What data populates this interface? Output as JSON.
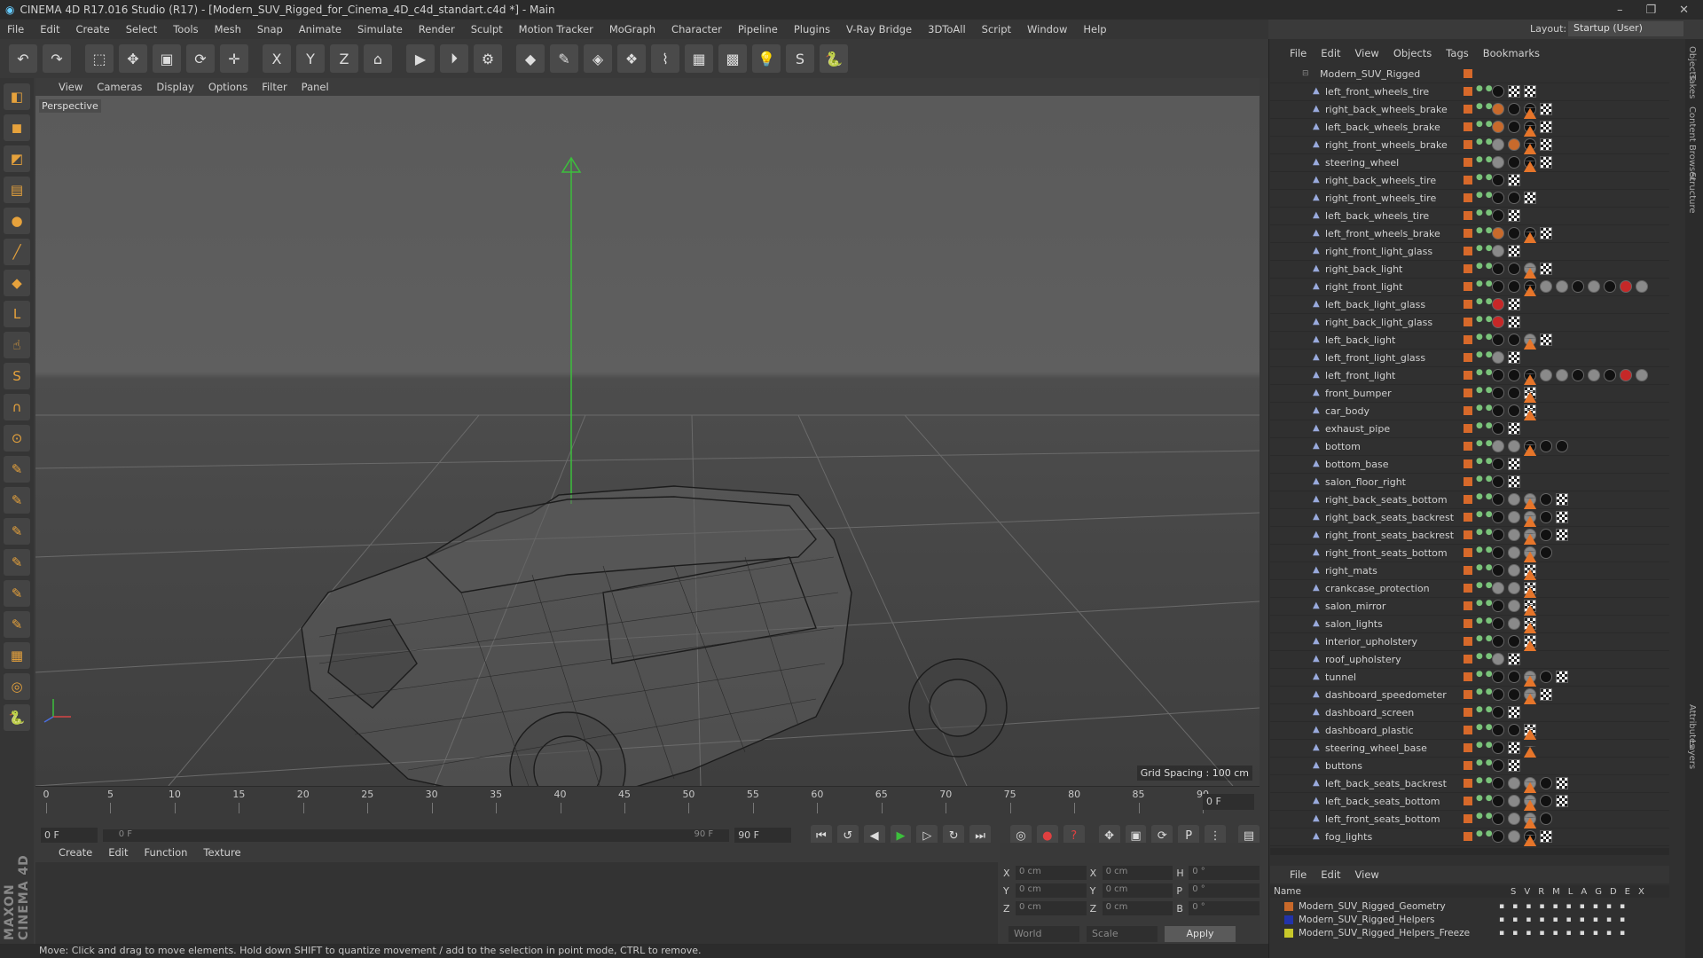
{
  "titlebar": {
    "title": "CINEMA 4D R17.016 Studio (R17) - [Modern_SUV_Rigged_for_Cinema_4D_c4d_standart.c4d *] - Main",
    "controls": [
      "–",
      "❐",
      "✕"
    ]
  },
  "menubar": [
    "File",
    "Edit",
    "Create",
    "Select",
    "Tools",
    "Mesh",
    "Snap",
    "Animate",
    "Simulate",
    "Render",
    "Sculpt",
    "Motion Tracker",
    "MoGraph",
    "Character",
    "Pipeline",
    "Plugins",
    "V-Ray Bridge",
    "3DToAll",
    "Script",
    "Window",
    "Help"
  ],
  "layout": {
    "label": "Layout:",
    "value": "Startup (User)"
  },
  "toolbar_icons": [
    "undo-icon",
    "redo-icon",
    "live-selection-icon",
    "move-icon",
    "scale-icon",
    "rotate-icon",
    "move-last-icon",
    "x-axis-icon",
    "y-axis-icon",
    "z-axis-icon",
    "world-coords-icon",
    "render-view-icon",
    "render-pic-icon",
    "render-settings-icon",
    "cube-icon",
    "pen-icon",
    "subdivision-icon",
    "array-icon",
    "deformer-icon",
    "floor-icon",
    "camera-icon",
    "light-icon",
    "vray-icon",
    "python-icon"
  ],
  "left_tools": [
    "make-editable-icon",
    "model-mode-icon",
    "texture-mode-icon",
    "workplane-icon",
    "points-mode-icon",
    "edges-mode-icon",
    "polygons-mode-icon",
    "axis-icon",
    "tweak-icon",
    "snap-icon",
    "magnet-icon",
    "lock-workplane-icon",
    "brush-icon",
    "brush2-icon",
    "brush3-icon",
    "brush4-icon",
    "brush5-icon",
    "brush6-icon",
    "grid-icon",
    "solo-icon",
    "python-icon"
  ],
  "viewport": {
    "menu": [
      "View",
      "Cameras",
      "Display",
      "Options",
      "Filter",
      "Panel"
    ],
    "label": "Perspective",
    "grid_spacing": "Grid Spacing : 100 cm"
  },
  "timeline": {
    "ticks": [
      "0",
      "5",
      "10",
      "15",
      "20",
      "25",
      "30",
      "35",
      "40",
      "45",
      "50",
      "55",
      "60",
      "65",
      "70",
      "75",
      "80",
      "85",
      "90"
    ],
    "current_frame": "0 F"
  },
  "transport": {
    "start": "0 F",
    "range_start": "0 F",
    "range_end": "90 F",
    "end": "90 F"
  },
  "materials": {
    "menu": [
      "Create",
      "Edit",
      "Function",
      "Texture"
    ]
  },
  "coords": {
    "rows": [
      {
        "a": "X",
        "av": "0 cm",
        "b": "X",
        "bv": "0 cm",
        "c": "H",
        "cv": "0 °"
      },
      {
        "a": "Y",
        "av": "0 cm",
        "b": "Y",
        "bv": "0 cm",
        "c": "P",
        "cv": "0 °"
      },
      {
        "a": "Z",
        "av": "0 cm",
        "b": "Z",
        "bv": "0 cm",
        "c": "B",
        "cv": "0 °"
      }
    ],
    "mode": "World",
    "type": "Scale",
    "apply": "Apply"
  },
  "statusbar": "Move: Click and drag to move elements. Hold down SHIFT to quantize movement / add to the selection in point mode, CTRL to remove.",
  "maxon": "MAXON CINEMA 4D",
  "objects": {
    "menu": [
      "File",
      "Edit",
      "View",
      "Objects",
      "Tags",
      "Bookmarks"
    ],
    "root": "Modern_SUV_Rigged",
    "items": [
      {
        "name": "left_front_wheels_tire",
        "tags": "bck"
      },
      {
        "name": "right_back_wheels_brake",
        "tags": "obbtttc"
      },
      {
        "name": "left_back_wheels_brake",
        "tags": "obbtttc"
      },
      {
        "name": "right_front_wheels_brake",
        "tags": "gobtttc"
      },
      {
        "name": "steering_wheel",
        "tags": "gbbtttc"
      },
      {
        "name": "right_back_wheels_tire",
        "tags": "bc"
      },
      {
        "name": "right_front_wheels_tire",
        "tags": "bbc"
      },
      {
        "name": "left_back_wheels_tire",
        "tags": "bc"
      },
      {
        "name": "left_front_wheels_brake",
        "tags": "obbtttc"
      },
      {
        "name": "right_front_light_glass",
        "tags": "gc"
      },
      {
        "name": "right_back_light",
        "tags": "bbgtttc"
      },
      {
        "name": "right_front_light",
        "tags": "bbbggbgbrgt"
      },
      {
        "name": "left_back_light_glass",
        "tags": "rc"
      },
      {
        "name": "right_back_light_glass",
        "tags": "rc"
      },
      {
        "name": "left_back_light",
        "tags": "bbgtttc"
      },
      {
        "name": "left_front_light_glass",
        "tags": "gc"
      },
      {
        "name": "left_front_light",
        "tags": "bbbggbgbrgt"
      },
      {
        "name": "front_bumper",
        "tags": "bbttc"
      },
      {
        "name": "car_body",
        "tags": "bbttc"
      },
      {
        "name": "exhaust_pipe",
        "tags": "bc"
      },
      {
        "name": "bottom",
        "tags": "ggbbbttttt"
      },
      {
        "name": "bottom_base",
        "tags": "bc"
      },
      {
        "name": "salon_floor_right",
        "tags": "bc"
      },
      {
        "name": "right_back_seats_bottom",
        "tags": "bggbttttc"
      },
      {
        "name": "right_back_seats_backrest",
        "tags": "bggbttttc"
      },
      {
        "name": "right_front_seats_backrest",
        "tags": "bggbttttc"
      },
      {
        "name": "right_front_seats_bottom",
        "tags": "bggbttttt"
      },
      {
        "name": "right_mats",
        "tags": "bgttc"
      },
      {
        "name": "crankcase_protection",
        "tags": "ggttc"
      },
      {
        "name": "salon_mirror",
        "tags": "bgttc"
      },
      {
        "name": "salon_lights",
        "tags": "bgttc"
      },
      {
        "name": "interior_upholstery",
        "tags": "bbttc"
      },
      {
        "name": "roof_upholstery",
        "tags": "gc"
      },
      {
        "name": "tunnel",
        "tags": "bbgbttttc"
      },
      {
        "name": "dashboard_speedometer",
        "tags": "bbgtttc"
      },
      {
        "name": "dashboard_screen",
        "tags": "bc"
      },
      {
        "name": "dashboard_plastic",
        "tags": "bbtttc"
      },
      {
        "name": "steering_wheel_base",
        "tags": "bttc"
      },
      {
        "name": "buttons",
        "tags": "bc"
      },
      {
        "name": "left_back_seats_backrest",
        "tags": "bggbttttc"
      },
      {
        "name": "left_back_seats_bottom",
        "tags": "bggbttttc"
      },
      {
        "name": "left_front_seats_bottom",
        "tags": "bggbttttt"
      },
      {
        "name": "fog_lights",
        "tags": "bgbttttc"
      }
    ]
  },
  "layers": {
    "menu": [
      "File",
      "Edit",
      "View"
    ],
    "header_name": "Name",
    "header_cols": [
      "S",
      "V",
      "R",
      "M",
      "L",
      "A",
      "G",
      "D",
      "E",
      "X"
    ],
    "items": [
      {
        "name": "Modern_SUV_Rigged_Geometry",
        "color": "#c8692a"
      },
      {
        "name": "Modern_SUV_Rigged_Helpers",
        "color": "#2233aa"
      },
      {
        "name": "Modern_SUV_Rigged_Helpers_Freeze",
        "color": "#c8c82a"
      }
    ]
  },
  "side_tabs": [
    "Objects",
    "Takes",
    "Content Browser",
    "Structure",
    "Attributes",
    "Layers"
  ]
}
